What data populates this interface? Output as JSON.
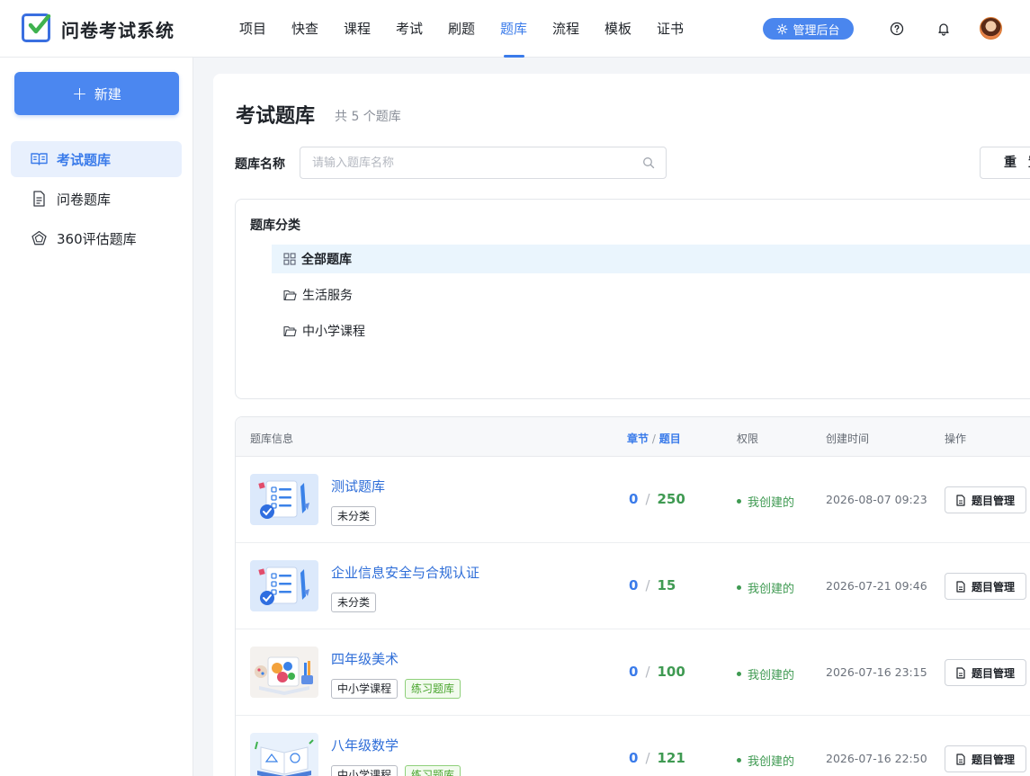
{
  "header": {
    "brand": "问卷考试系统",
    "nav": [
      {
        "label": "项目",
        "active": false
      },
      {
        "label": "快查",
        "active": false
      },
      {
        "label": "课程",
        "active": false
      },
      {
        "label": "考试",
        "active": false
      },
      {
        "label": "刷题",
        "active": false
      },
      {
        "label": "题库",
        "active": true
      },
      {
        "label": "流程",
        "active": false
      },
      {
        "label": "模板",
        "active": false
      },
      {
        "label": "证书",
        "active": false
      }
    ],
    "admin_label": "管理后台",
    "icons": [
      "help-circle-icon",
      "bell-icon",
      "avatar"
    ]
  },
  "sidebar": {
    "new_label": "新建",
    "items": [
      {
        "label": "考试题库",
        "icon": "open-book-icon",
        "active": true
      },
      {
        "label": "问卷题库",
        "icon": "document-icon",
        "active": false
      },
      {
        "label": "360评估题库",
        "icon": "pentagon-icon",
        "active": false
      }
    ]
  },
  "main": {
    "title": "考试题库",
    "subtitle": "共 5 个题库",
    "filter_label": "题库名称",
    "search_placeholder": "请输入题库名称",
    "reset_label": "重 置",
    "category": {
      "title": "题库分类",
      "items": [
        {
          "label": "全部题库",
          "icon": "grid-icon",
          "active": true
        },
        {
          "label": "生活服务",
          "icon": "folder-icon",
          "active": false
        },
        {
          "label": "中小学课程",
          "icon": "folder-icon",
          "active": false
        }
      ]
    },
    "table": {
      "headers": {
        "info": "题库信息",
        "chapter": "章节",
        "slash": "/",
        "question": "题目",
        "permission": "权限",
        "created": "创建时间",
        "action": "操作"
      },
      "rows": [
        {
          "name": "测试题库",
          "tags": [
            {
              "text": "未分类",
              "style": "plain"
            }
          ],
          "chapters": "0",
          "questions": "250",
          "permission": "我创建的",
          "created": "2026-08-07 09:23",
          "action": "题目管理",
          "thumb": "checklist"
        },
        {
          "name": "企业信息安全与合规认证",
          "tags": [
            {
              "text": "未分类",
              "style": "plain"
            }
          ],
          "chapters": "0",
          "questions": "15",
          "permission": "我创建的",
          "created": "2026-07-21 09:46",
          "action": "题目管理",
          "thumb": "checklist"
        },
        {
          "name": "四年级美术",
          "tags": [
            {
              "text": "中小学课程",
              "style": "plain"
            },
            {
              "text": "练习题库",
              "style": "green"
            }
          ],
          "chapters": "0",
          "questions": "100",
          "permission": "我创建的",
          "created": "2026-07-16 23:15",
          "action": "题目管理",
          "thumb": "art"
        },
        {
          "name": "八年级数学",
          "tags": [
            {
              "text": "中小学课程",
              "style": "plain"
            },
            {
              "text": "练习题库",
              "style": "green"
            }
          ],
          "chapters": "0",
          "questions": "121",
          "permission": "我创建的",
          "created": "2026-07-16 22:50",
          "action": "题目管理",
          "thumb": "math"
        }
      ]
    }
  },
  "colors": {
    "accent": "#3a7bea",
    "green": "#3f9a52",
    "primary_button": "#4b87f0"
  }
}
